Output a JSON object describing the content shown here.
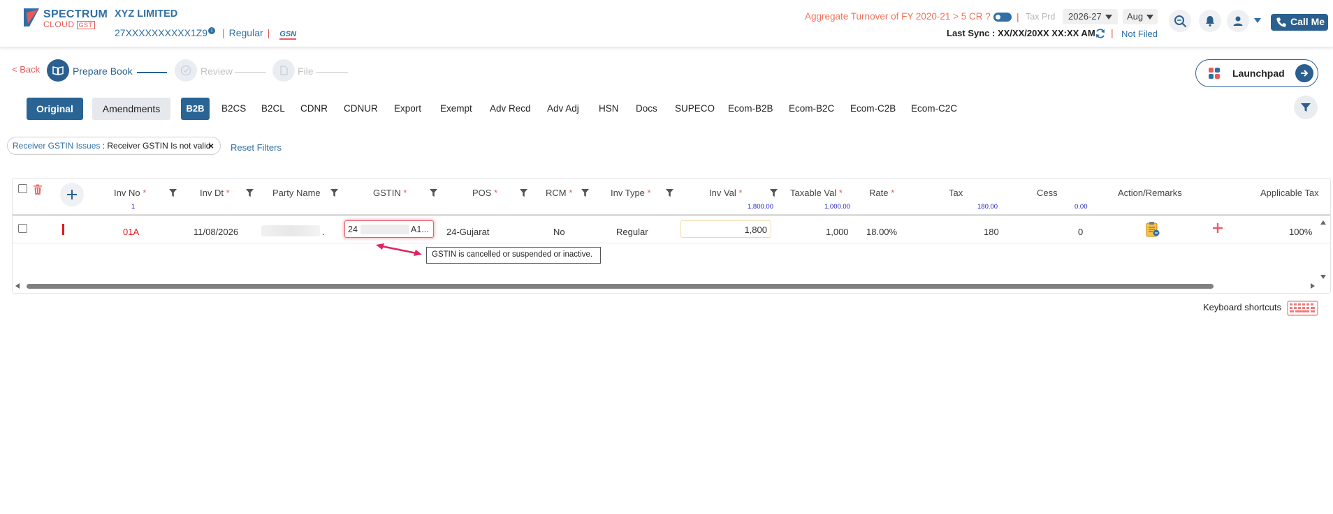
{
  "header": {
    "logo_line1": "SPECTRUM",
    "logo_line2": "CLOUD",
    "logo_gst": "GST",
    "company_name": "XYZ LIMITED",
    "gstin": "27XXXXXXXXXX1Z9",
    "info_symbol": "i",
    "reg_type": "Regular",
    "separator": "|",
    "gsn_logo": "GSN",
    "turnover_question": "Aggregate Turnover of FY 2020-21 > 5 CR ?",
    "tax_period_label": "Tax Prd",
    "year": "2026-27",
    "month": "Aug",
    "call_me": "Call Me",
    "last_sync": "Last Sync : XX/XX/20XX XX:XX AM",
    "filing_status": "Not Filed"
  },
  "stepper": {
    "back": "< Back",
    "steps": [
      {
        "label": "Prepare Book",
        "active": true
      },
      {
        "label": "Review",
        "active": false
      },
      {
        "label": "File",
        "active": false
      }
    ]
  },
  "launchpad_label": "Launchpad",
  "tabs": {
    "original": "Original",
    "amendments": "Amendments",
    "sections": [
      "B2B",
      "B2CS",
      "B2CL",
      "CDNR",
      "CDNUR",
      "Export",
      "Exempt",
      "Adv Recd",
      "Adv Adj",
      "HSN",
      "Docs",
      "SUPECO",
      "Ecom-B2B",
      "Ecom-B2C",
      "Ecom-C2B",
      "Ecom-C2C"
    ],
    "active_section": "B2B"
  },
  "filter_chip": {
    "key": "Receiver GSTIN Issues",
    "value": " : Receiver GSTIN Is not valid",
    "close": "×"
  },
  "reset_filters": "Reset Filters",
  "table": {
    "columns": {
      "inv_no": "Inv No",
      "inv_dt": "Inv Dt",
      "party_name": "Party Name",
      "gstin": "GSTIN",
      "pos": "POS",
      "rcm": "RCM",
      "inv_type": "Inv Type",
      "inv_val": "Inv Val",
      "taxable_val": "Taxable Val",
      "rate": "Rate",
      "tax": "Tax",
      "cess": "Cess",
      "action": "Action/Remarks",
      "applicable_tax": "Applicable Tax"
    },
    "required_mark": "*",
    "summary": {
      "inv_no": "1",
      "inv_val": "1,800.00",
      "taxable_val": "1,000.00",
      "tax": "180.00",
      "cess": "0.00"
    },
    "row": {
      "inv_no": "01A",
      "inv_dt": "11/08/2026",
      "party_name_suffix": ".",
      "gstin_prefix": "24",
      "gstin_suffix": "A1...",
      "pos": "24-Gujarat",
      "rcm": "No",
      "inv_type": "Regular",
      "inv_val": "1,800",
      "taxable_val": "1,000",
      "rate": "18.00%",
      "tax": "180",
      "cess": "0",
      "applicable_tax": "100%"
    }
  },
  "tooltip": "GSTIN is cancelled or suspended or inactive.",
  "keyboard_shortcuts": "Keyboard shortcuts",
  "colors": {
    "primary": "#2a6494",
    "accent_red": "#e85a5a",
    "link_blue": "#2f6fa5",
    "error_border": "#ee5b6a"
  }
}
